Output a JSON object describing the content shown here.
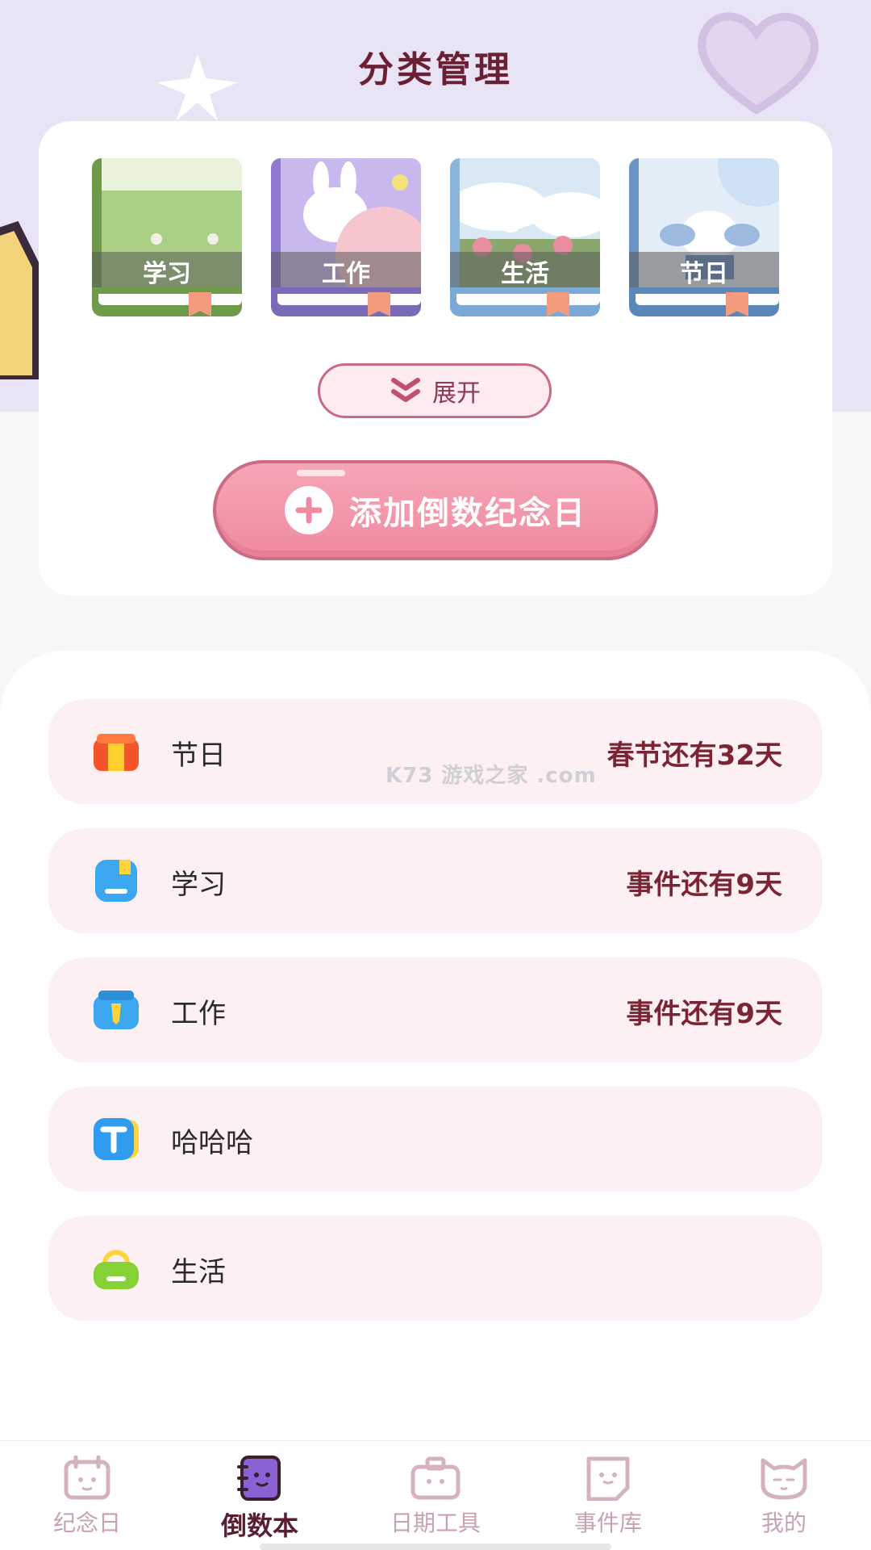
{
  "header": {
    "title": "分类管理"
  },
  "categories": [
    {
      "label": "学习",
      "theme": "#6f9a4a",
      "cover": "#b9d89a",
      "icon": "grass-field-scene"
    },
    {
      "label": "工作",
      "theme": "#7a6ab8",
      "cover": "#c6b5ec",
      "icon": "bunny-scene"
    },
    {
      "label": "生活",
      "theme": "#7aa9d6",
      "cover": "#cfe3f3",
      "icon": "tulip-scene"
    },
    {
      "label": "节日",
      "theme": "#5b86b8",
      "cover": "#dbe8f6",
      "icon": "princess-bunny-scene"
    }
  ],
  "expand_button": {
    "label": "展开",
    "icon": "double-chevron-down-icon"
  },
  "add_button": {
    "label": "添加倒数纪念日",
    "icon": "plus-circle-icon"
  },
  "watermark": "K73 游戏之家 .com",
  "list": [
    {
      "name": "节日",
      "info": "春节还有32天",
      "icon": "gift-icon"
    },
    {
      "name": "学习",
      "info": "事件还有9天",
      "icon": "book-icon"
    },
    {
      "name": "工作",
      "info": "事件还有9天",
      "icon": "briefcase-icon"
    },
    {
      "name": "哈哈哈",
      "info": "",
      "icon": "text-t-icon"
    },
    {
      "name": "生活",
      "info": "",
      "icon": "basket-icon"
    }
  ],
  "nav": [
    {
      "label": "纪念日",
      "icon": "calendar-face-icon",
      "active": false
    },
    {
      "label": "倒数本",
      "icon": "notebook-icon",
      "active": true
    },
    {
      "label": "日期工具",
      "icon": "toolbox-icon",
      "active": false
    },
    {
      "label": "事件库",
      "icon": "note-library-icon",
      "active": false
    },
    {
      "label": "我的",
      "icon": "cat-face-icon",
      "active": false
    }
  ],
  "colors": {
    "accent": "#ef8ba1",
    "title": "#6b1f33",
    "row_bg": "#fdf0f3",
    "nav_active": "#5a1f2f"
  }
}
